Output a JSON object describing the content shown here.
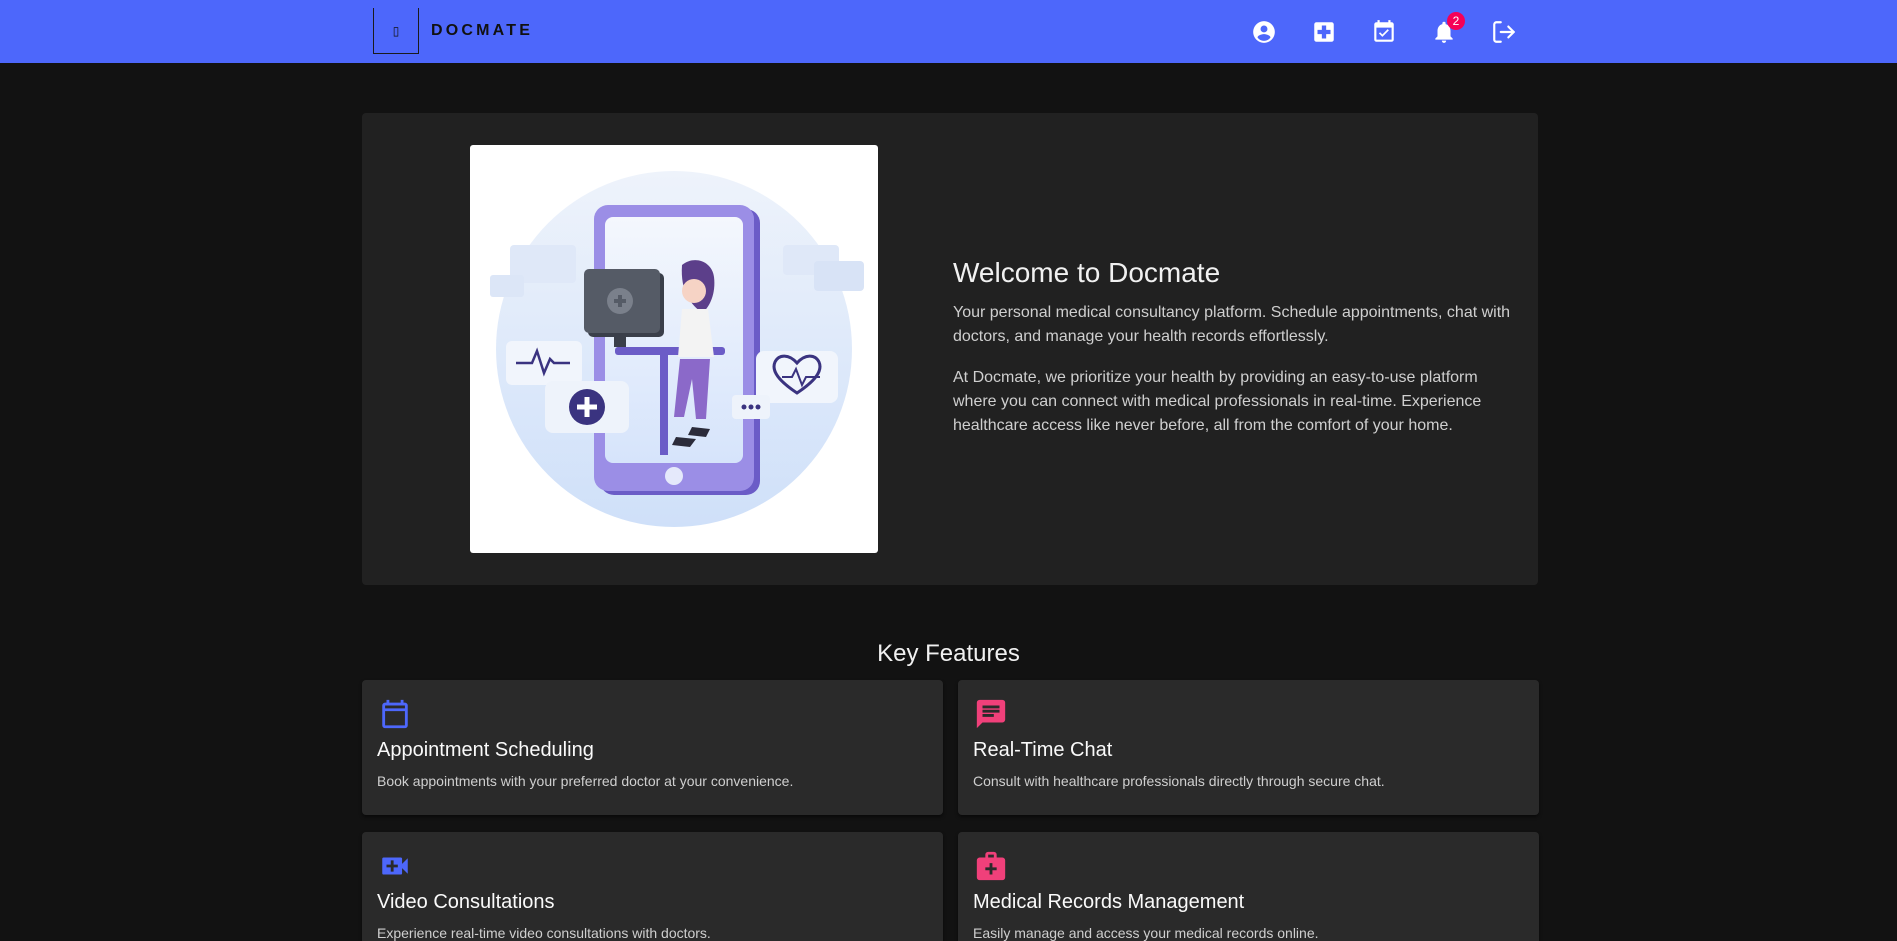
{
  "header": {
    "logo_glyph": "▯",
    "brand": "DOCMATE",
    "notification_count": "2",
    "icons": [
      "account-circle-icon",
      "medical-plus-icon",
      "calendar-check-icon",
      "bell-icon",
      "logout-icon"
    ],
    "bar_color": "#4d67fb"
  },
  "hero": {
    "title": "Welcome to Docmate",
    "paragraph1": "Your personal medical consultancy platform. Schedule appointments, chat with doctors, and manage your health records effortlessly.",
    "paragraph2": "At Docmate, we prioritize your health by providing an easy-to-use platform where you can connect with medical professionals in real-time. Experience healthcare access like never before, all from the comfort of your home."
  },
  "features": {
    "title": "Key Features",
    "items": [
      {
        "title": "Appointment Scheduling",
        "desc": "Book appointments with your preferred doctor at your convenience.",
        "icon": "calendar-icon",
        "color": "#4d67fb"
      },
      {
        "title": "Real-Time Chat",
        "desc": "Consult with healthcare professionals directly through secure chat.",
        "icon": "chat-icon",
        "color": "#f0407a"
      },
      {
        "title": "Video Consultations",
        "desc": "Experience real-time video consultations with doctors.",
        "icon": "video-call-icon",
        "color": "#4d67fb"
      },
      {
        "title": "Medical Records Management",
        "desc": "Easily manage and access your medical records online.",
        "icon": "medical-bag-icon",
        "color": "#f0407a"
      }
    ]
  }
}
